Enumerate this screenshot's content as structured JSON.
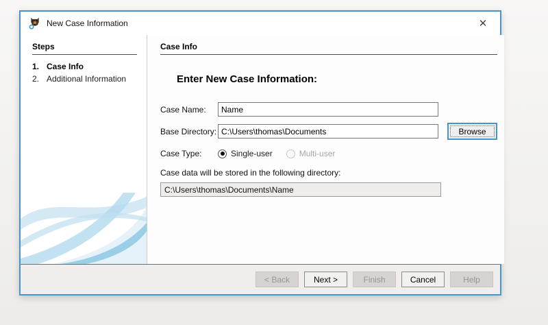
{
  "window": {
    "title": "New Case Information",
    "close_glyph": "✕",
    "app_icon": "autopsy-dog-icon"
  },
  "steps": {
    "header": "Steps",
    "items": [
      {
        "number": "1.",
        "label": "Case Info",
        "active": true
      },
      {
        "number": "2.",
        "label": "Additional Information",
        "active": false
      }
    ]
  },
  "content": {
    "header": "Case Info",
    "title": "Enter New Case Information:",
    "fields": {
      "case_name": {
        "label": "Case Name:",
        "value": "Name"
      },
      "base_directory": {
        "label": "Base Directory:",
        "value": "C:\\Users\\thomas\\Documents",
        "browse_label": "Browse"
      },
      "case_type": {
        "label": "Case Type:",
        "options": [
          {
            "label": "Single-user",
            "selected": true,
            "enabled": true
          },
          {
            "label": "Multi-user",
            "selected": false,
            "enabled": false
          }
        ]
      },
      "storage_note": "Case data will be stored in the following directory:",
      "storage_path": "C:\\Users\\thomas\\Documents\\Name"
    }
  },
  "buttons": [
    {
      "label": "< Back",
      "enabled": false
    },
    {
      "label": "Next >",
      "enabled": true
    },
    {
      "label": "Finish",
      "enabled": false
    },
    {
      "label": "Cancel",
      "enabled": true
    },
    {
      "label": "Help",
      "enabled": false
    }
  ],
  "colors": {
    "window_border": "#4a94c4",
    "focus_accent": "#4596c7",
    "swoosh_blue": "#b7dcee"
  }
}
